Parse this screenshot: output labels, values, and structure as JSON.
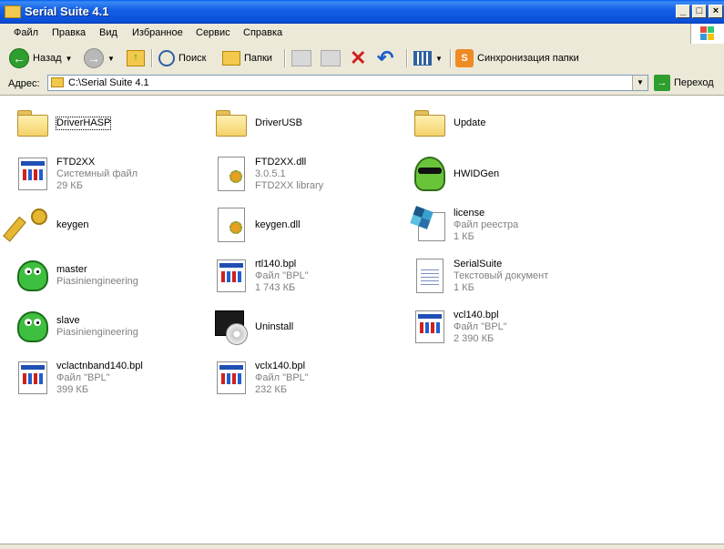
{
  "window": {
    "title": "Serial Suite 4.1"
  },
  "menu": [
    "Файл",
    "Правка",
    "Вид",
    "Избранное",
    "Сервис",
    "Справка"
  ],
  "toolbar": {
    "back_label": "Назад",
    "search_label": "Поиск",
    "folders_label": "Папки",
    "sync_label": "Синхронизация папки"
  },
  "address": {
    "label": "Адрес:",
    "value": "C:\\Serial Suite 4.1",
    "go_label": "Переход"
  },
  "items": [
    {
      "name": "DriverHASP",
      "line2": "",
      "line3": "",
      "icon": "folder-icon"
    },
    {
      "name": "DriverUSB",
      "line2": "",
      "line3": "",
      "icon": "folder-icon"
    },
    {
      "name": "Update",
      "line2": "",
      "line3": "",
      "icon": "folder-icon"
    },
    {
      "name": "FTD2XX",
      "line2": "Системный файл",
      "line3": "29 КБ",
      "icon": "system-file-icon"
    },
    {
      "name": "FTD2XX.dll",
      "line2": "3.0.5.1",
      "line3": "FTD2XX library",
      "icon": "dll-file-icon"
    },
    {
      "name": "HWIDGen",
      "line2": "",
      "line3": "",
      "icon": "hwidgen-icon"
    },
    {
      "name": "keygen",
      "line2": "",
      "line3": "",
      "icon": "key-icon"
    },
    {
      "name": "keygen.dll",
      "line2": "",
      "line3": "",
      "icon": "dll-file-icon"
    },
    {
      "name": "license",
      "line2": "Файл реестра",
      "line3": "1 КБ",
      "icon": "registry-file-icon"
    },
    {
      "name": "master",
      "line2": "Piasiniengineering",
      "line3": "",
      "icon": "green-blob-icon"
    },
    {
      "name": "rtl140.bpl",
      "line2": "Файл \"BPL\"",
      "line3": "1 743 КБ",
      "icon": "bpl-file-icon"
    },
    {
      "name": "SerialSuite",
      "line2": "Текстовый документ",
      "line3": "1 КБ",
      "icon": "text-document-icon"
    },
    {
      "name": "slave",
      "line2": "Piasiniengineering",
      "line3": "",
      "icon": "green-blob-icon"
    },
    {
      "name": "Uninstall",
      "line2": "",
      "line3": "",
      "icon": "installer-icon"
    },
    {
      "name": "vcl140.bpl",
      "line2": "Файл \"BPL\"",
      "line3": "2 390 КБ",
      "icon": "bpl-file-icon"
    },
    {
      "name": "vclactnband140.bpl",
      "line2": "Файл \"BPL\"",
      "line3": "399 КБ",
      "icon": "bpl-file-icon"
    },
    {
      "name": "vclx140.bpl",
      "line2": "Файл \"BPL\"",
      "line3": "232 КБ",
      "icon": "bpl-file-icon"
    }
  ]
}
